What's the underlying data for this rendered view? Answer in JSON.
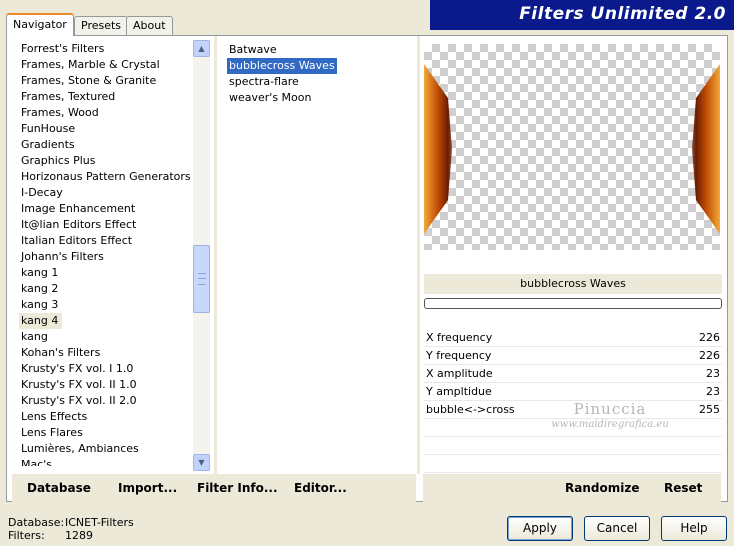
{
  "app": {
    "title": "Filters Unlimited 2.0"
  },
  "tabs": [
    {
      "label": "Navigator",
      "active": true
    },
    {
      "label": "Presets",
      "active": false
    },
    {
      "label": "About",
      "active": false
    }
  ],
  "categories": [
    "Forrest's Filters",
    "Frames, Marble & Crystal",
    "Frames, Stone & Granite",
    "Frames, Textured",
    "Frames, Wood",
    "FunHouse",
    "Gradients",
    "Graphics Plus",
    "Horizonaus Pattern Generators",
    "I-Decay",
    "Image Enhancement",
    "It@lian Editors Effect",
    "Italian Editors Effect",
    "Johann's Filters",
    "kang 1",
    "kang 2",
    "kang 3",
    "kang 4",
    "kang",
    "Kohan's Filters",
    "Krusty's FX vol. I 1.0",
    "Krusty's FX vol. II 1.0",
    "Krusty's FX vol. II 2.0",
    "Lens Effects",
    "Lens Flares",
    "Lumières, Ambiances",
    "Mac's"
  ],
  "selected_category": "kang 4",
  "filters": [
    "Batwave",
    "bubblecross Waves",
    "spectra-flare",
    "weaver's Moon"
  ],
  "selected_filter": "bubblecross Waves",
  "preview_filter_name": "bubblecross Waves",
  "params": [
    {
      "label": "X frequency",
      "value": "226"
    },
    {
      "label": "Y frequency",
      "value": "226"
    },
    {
      "label": "X amplitude",
      "value": "23"
    },
    {
      "label": "Y ampltidue",
      "value": "23"
    },
    {
      "label": "bubble<->cross",
      "value": "255"
    }
  ],
  "watermark": {
    "name": "Pinuccia",
    "url": "www.maidiregrafica.eu"
  },
  "bottom_left": {
    "database": "Database",
    "import": "Import...",
    "filter_info": "Filter Info...",
    "editor": "Editor..."
  },
  "bottom_right": {
    "randomize": "Randomize",
    "reset": "Reset"
  },
  "status": {
    "database_label": "Database:",
    "database_value": "ICNET-Filters",
    "filters_label": "Filters:",
    "filters_value": "1289"
  },
  "buttons": {
    "apply": "Apply",
    "cancel": "Cancel",
    "help": "Help"
  },
  "colors": {
    "selection": "#316ac5",
    "banner": "#0a1a8c",
    "tab_accent": "#e68b2c",
    "window": "#ece9d8"
  }
}
